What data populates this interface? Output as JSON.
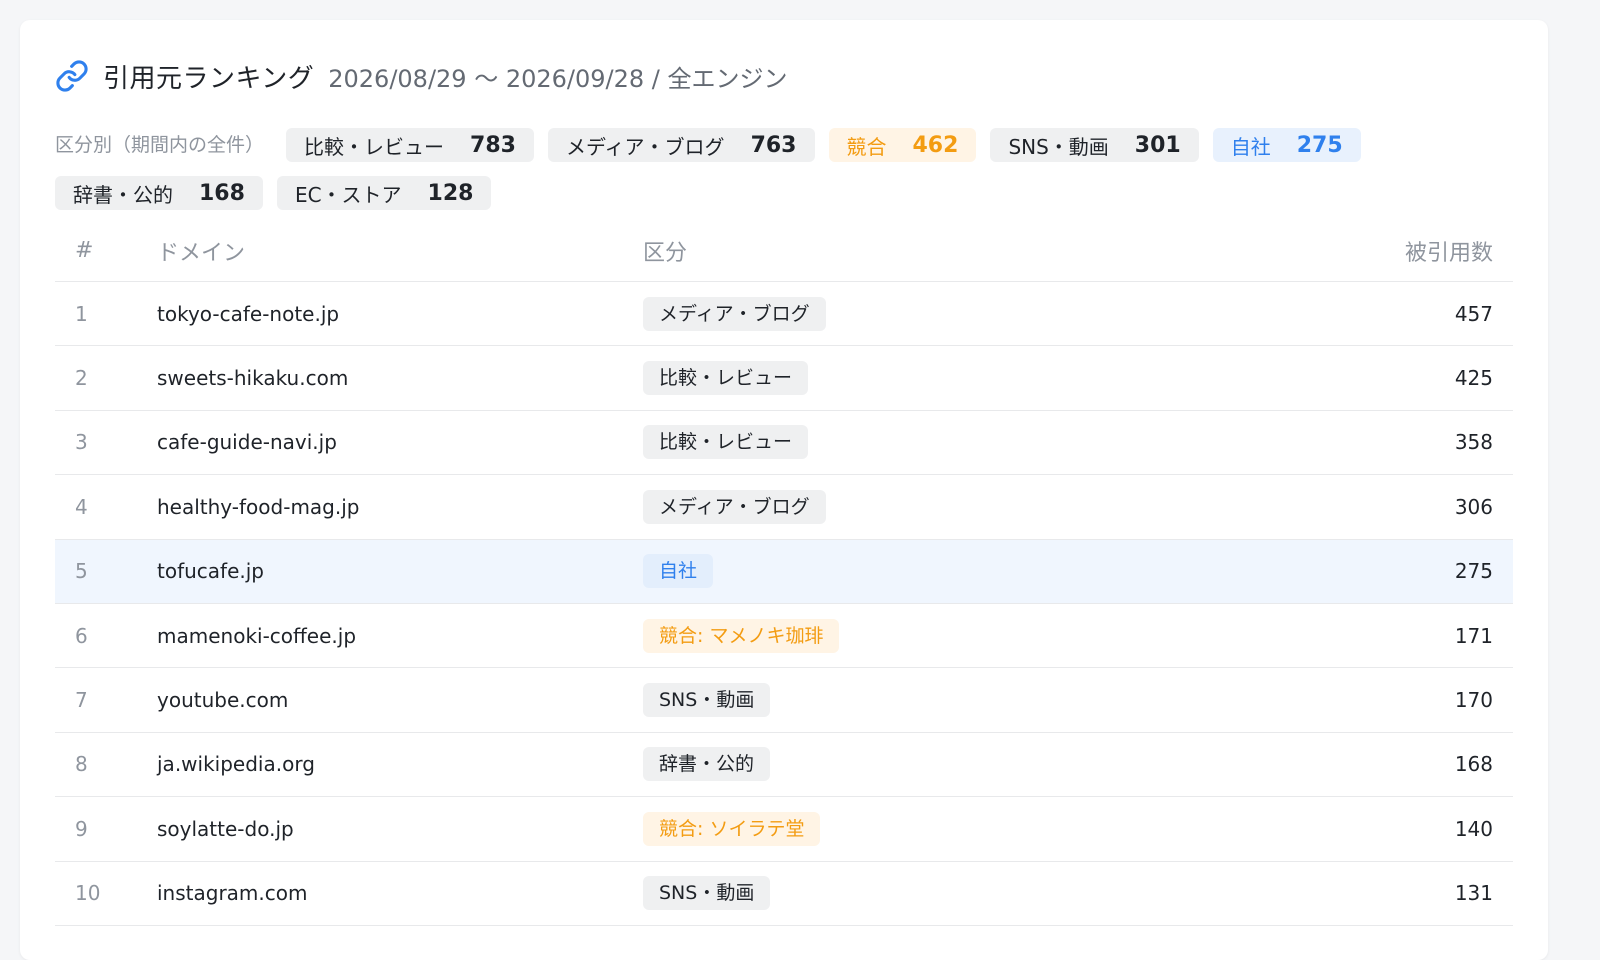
{
  "header": {
    "title": "引用元ランキング",
    "subtitle": "2026/08/29 〜 2026/09/28 / 全エンジン"
  },
  "filters": {
    "label": "区分別（期間内の全件）",
    "chips": [
      {
        "label": "比較・レビュー",
        "count": "783",
        "tone": "gray"
      },
      {
        "label": "メディア・ブログ",
        "count": "763",
        "tone": "gray"
      },
      {
        "label": "競合",
        "count": "462",
        "tone": "orange"
      },
      {
        "label": "SNS・動画",
        "count": "301",
        "tone": "gray"
      },
      {
        "label": "自社",
        "count": "275",
        "tone": "blue"
      },
      {
        "label": "辞書・公的",
        "count": "168",
        "tone": "gray"
      },
      {
        "label": "EC・ストア",
        "count": "128",
        "tone": "gray"
      }
    ]
  },
  "table": {
    "headers": {
      "rank": "#",
      "domain": "ドメイン",
      "category": "区分",
      "count": "被引用数"
    },
    "rows": [
      {
        "rank": "1",
        "domain": "tokyo-cafe-note.jp",
        "category": "メディア・ブログ",
        "tone": "gray",
        "count": "457"
      },
      {
        "rank": "2",
        "domain": "sweets-hikaku.com",
        "category": "比較・レビュー",
        "tone": "gray",
        "count": "425"
      },
      {
        "rank": "3",
        "domain": "cafe-guide-navi.jp",
        "category": "比較・レビュー",
        "tone": "gray",
        "count": "358"
      },
      {
        "rank": "4",
        "domain": "healthy-food-mag.jp",
        "category": "メディア・ブログ",
        "tone": "gray",
        "count": "306"
      },
      {
        "rank": "5",
        "domain": "tofucafe.jp",
        "category": "自社",
        "tone": "blue",
        "count": "275",
        "highlight": true
      },
      {
        "rank": "6",
        "domain": "mamenoki-coffee.jp",
        "category": "競合: マメノキ珈琲",
        "tone": "orange",
        "count": "171"
      },
      {
        "rank": "7",
        "domain": "youtube.com",
        "category": "SNS・動画",
        "tone": "gray",
        "count": "170"
      },
      {
        "rank": "8",
        "domain": "ja.wikipedia.org",
        "category": "辞書・公的",
        "tone": "gray",
        "count": "168"
      },
      {
        "rank": "9",
        "domain": "soylatte-do.jp",
        "category": "競合: ソイラテ堂",
        "tone": "orange",
        "count": "140"
      },
      {
        "rank": "10",
        "domain": "instagram.com",
        "category": "SNS・動画",
        "tone": "gray",
        "count": "131"
      }
    ]
  },
  "colors": {
    "accent": "#2f80ed",
    "competitor": "#f39c12",
    "chip_gray": "#eff0f1",
    "highlight_row": "#f0f6fe"
  },
  "icons": {
    "title": "link-icon"
  }
}
